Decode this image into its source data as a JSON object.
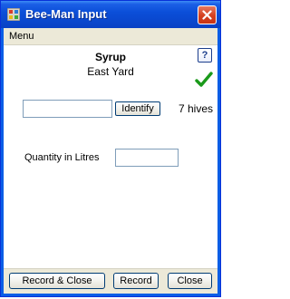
{
  "window": {
    "title": "Bee-Man Input",
    "accent_color": "#0a5ee6",
    "icon": "bee-man-app-icon"
  },
  "menu": {
    "items": [
      {
        "label": "Menu"
      }
    ]
  },
  "header": {
    "product": "Syrup",
    "location": "East Yard",
    "help_label": "?",
    "status_icon": "check-icon",
    "status_color": "#1a9a1a"
  },
  "hive": {
    "input_value": "",
    "identify_label": "Identify",
    "count_text": "7 hives"
  },
  "quantity": {
    "label": "Quantity in Litres",
    "value": ""
  },
  "footer": {
    "record_close_label": "Record & Close",
    "record_label": "Record",
    "close_label": "Close"
  }
}
